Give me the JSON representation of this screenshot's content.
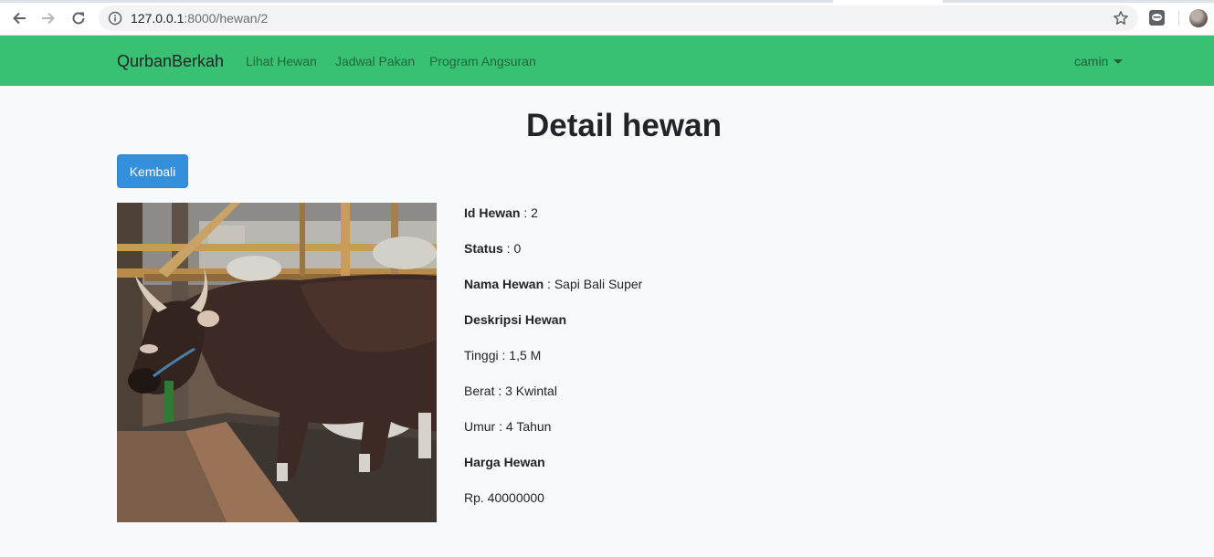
{
  "browser": {
    "url_host": "127.0.0.1",
    "url_path": ":8000/hewan/2",
    "icons": [
      "back-icon",
      "forward-icon",
      "reload-icon",
      "info-icon",
      "star-icon",
      "extension-icon",
      "profile-avatar"
    ]
  },
  "navbar": {
    "brand": "QurbanBerkah",
    "links": [
      "Lihat Hewan",
      "Jadwal Pakan",
      "Program Angsuran"
    ],
    "user": "camin",
    "color": "#38c172"
  },
  "page": {
    "title": "Detail hewan",
    "back_button": "Kembali",
    "button_color": "#3490dc"
  },
  "animal": {
    "image_subject": "brown bali cow in a pen",
    "id_label": "Id Hewan",
    "id_value": " : 2",
    "status_label": "Status",
    "status_value": " : 0",
    "name_label": "Nama Hewan",
    "name_value": " : Sapi Bali Super",
    "description_heading": "Deskripsi Hewan",
    "height": "Tinggi : 1,5 M",
    "weight": "Berat : 3 Kwintal",
    "age": "Umur : 4 Tahun",
    "price_heading": "Harga Hewan",
    "price": "Rp. 40000000"
  }
}
